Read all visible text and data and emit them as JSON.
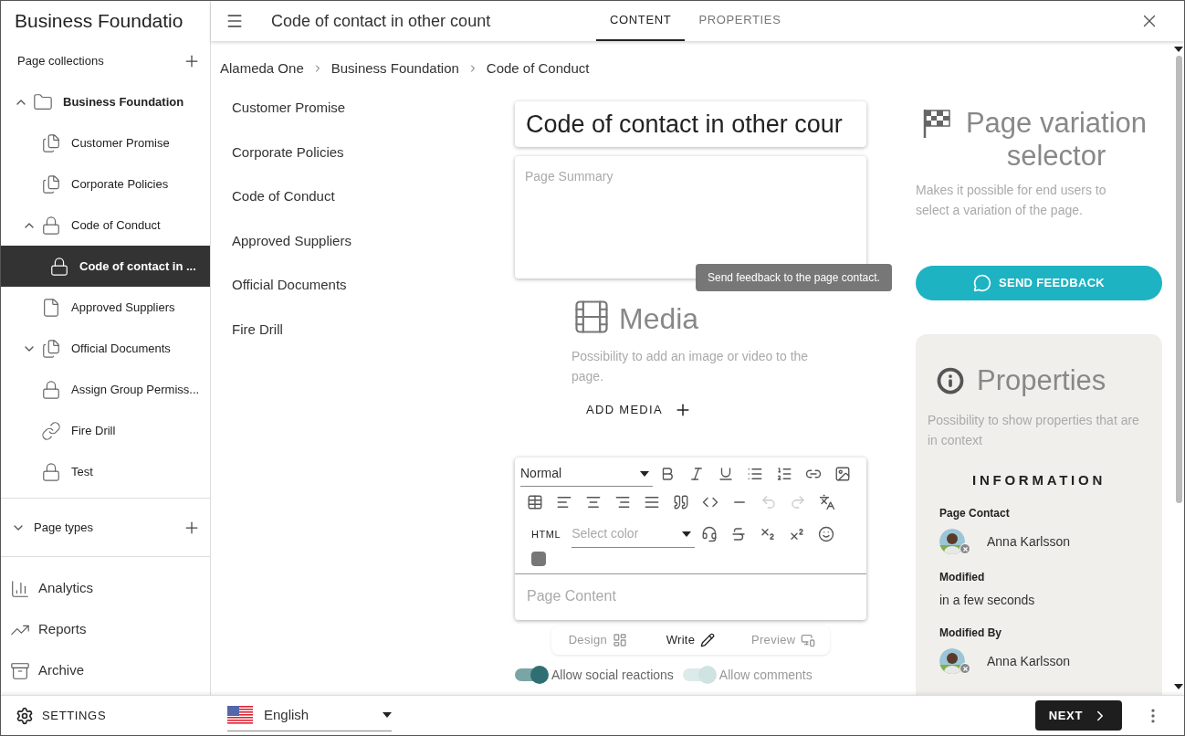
{
  "app_title": "Business Foundatio",
  "sidebar": {
    "section_label": "Page collections",
    "tree": [
      {
        "label": "Business Foundation",
        "kind": "folder",
        "expanded": true,
        "selected": false,
        "children": [
          {
            "label": "Customer Promise",
            "kind": "pages",
            "selected": false
          },
          {
            "label": "Corporate Policies",
            "kind": "pages",
            "selected": false
          },
          {
            "label": "Code of Conduct",
            "kind": "lock",
            "expanded": true,
            "selected": false,
            "children": [
              {
                "label": "Code of contact in ...",
                "kind": "lock",
                "selected": true
              }
            ]
          },
          {
            "label": "Approved Suppliers",
            "kind": "page",
            "selected": false
          },
          {
            "label": "Official Documents",
            "kind": "pages",
            "expanded": false,
            "selected": false
          },
          {
            "label": "Assign Group Permiss...",
            "kind": "lock",
            "selected": false
          },
          {
            "label": "Fire Drill",
            "kind": "link",
            "selected": false
          },
          {
            "label": "Test",
            "kind": "lock",
            "selected": false
          }
        ]
      }
    ],
    "page_types": {
      "label": "Page types",
      "expanded": false
    },
    "nav": [
      {
        "label": "Analytics",
        "kind": "analytics"
      },
      {
        "label": "Reports",
        "kind": "reports"
      },
      {
        "label": "Archive",
        "kind": "archive"
      }
    ],
    "settings": "SETTINGS"
  },
  "topbar": {
    "title": "Code of contact in other count",
    "tabs": [
      {
        "label": "CONTENT",
        "selected": true
      },
      {
        "label": "PROPERTIES",
        "selected": false
      }
    ]
  },
  "breadcrumb": [
    "Alameda One",
    "Business Foundation",
    "Code of Conduct"
  ],
  "page_list": [
    "Customer Promise",
    "Corporate Policies",
    "Code of Conduct",
    "Approved Suppliers",
    "Official Documents",
    "Fire Drill"
  ],
  "editor": {
    "title_value": "Code of contact in other cour",
    "summary_placeholder": "Page Summary",
    "format": "Normal",
    "html": "HTML",
    "color_placeholder": "Select color",
    "content_placeholder": "Page Content"
  },
  "media": {
    "title": "Media",
    "description": "Possibility to add an image or video to the page.",
    "button": "ADD MEDIA"
  },
  "modes": [
    {
      "label": "Design",
      "selected": false
    },
    {
      "label": "Write",
      "selected": true
    },
    {
      "label": "Preview",
      "selected": false
    }
  ],
  "toggles": [
    {
      "label": "Allow social reactions",
      "on": true,
      "disabled": false
    },
    {
      "label": "Allow comments",
      "on": true,
      "disabled": true
    }
  ],
  "variation": {
    "title": "Page variation selector",
    "description": "Makes it possible for end users to select a variation of the page."
  },
  "tooltip": "Send feedback to the page contact.",
  "feedback_button": "SEND FEEDBACK",
  "properties": {
    "title": "Properties",
    "description": "Possibility to show properties that are in context",
    "heading": "INFORMATION",
    "fields": [
      {
        "label": "Page Contact",
        "kind": "person",
        "value": "Anna Karlsson"
      },
      {
        "label": "Modified",
        "kind": "text",
        "value": "in a few seconds"
      },
      {
        "label": "Modified By",
        "kind": "person",
        "value": "Anna Karlsson"
      }
    ]
  },
  "footer": {
    "language": "English",
    "next": "NEXT"
  }
}
